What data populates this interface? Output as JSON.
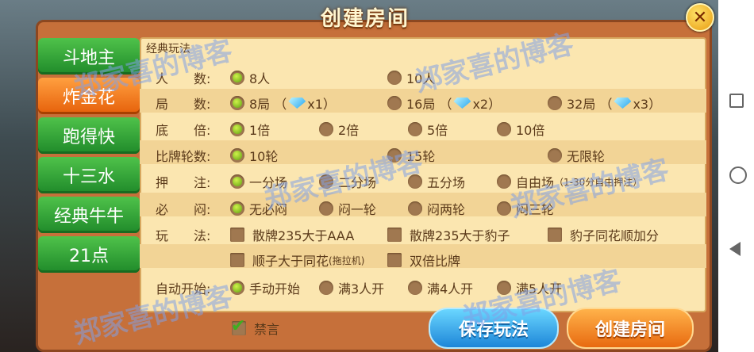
{
  "title": "创建房间",
  "close_icon_glyph": "✕",
  "tabs": [
    {
      "label": "斗地主",
      "active": false
    },
    {
      "label": "炸金花",
      "active": true
    },
    {
      "label": "跑得快",
      "active": false
    },
    {
      "label": "十三水",
      "active": false
    },
    {
      "label": "经典牛牛",
      "active": false
    },
    {
      "label": "21点",
      "active": false
    }
  ],
  "section_label": "经典玩法",
  "rows": {
    "players": {
      "label": "人　　数:",
      "options": [
        "8人",
        "10人"
      ],
      "selected": 0
    },
    "rounds": {
      "label": "局　　数:",
      "options": [
        {
          "pre": "8局 （",
          "post": "x1）"
        },
        {
          "pre": "16局 （",
          "post": "x2）"
        },
        {
          "pre": "32局 （",
          "post": "x3）"
        }
      ],
      "selected": 0
    },
    "base": {
      "label": "底　　倍:",
      "options": [
        "1倍",
        "2倍",
        "5倍",
        "10倍"
      ],
      "selected": 0
    },
    "compare": {
      "label": "比牌轮数:",
      "options": [
        "10轮",
        "15轮",
        "无限轮"
      ],
      "selected": 0
    },
    "bet": {
      "label": "押　　注:",
      "options": [
        "一分场",
        "二分场",
        "五分场"
      ],
      "free": {
        "main": "自由场",
        "sub": "（1-30分自由押注）"
      },
      "selected": 0
    },
    "blind": {
      "label": "必　　闷:",
      "options": [
        "无必闷",
        "闷一轮",
        "闷两轮",
        "闷三轮"
      ],
      "selected": 0
    },
    "play": {
      "label": "玩　　法:",
      "options": [
        "散牌235大于AAA",
        "散牌235大于豹子",
        "豹子同花顺加分",
        "双倍比牌"
      ],
      "straight": {
        "main": "顺子大于同花",
        "sub": "(拖拉机)"
      }
    },
    "autostart": {
      "label": "自动开始:",
      "options": [
        "手动开始",
        "满3人开",
        "满4人开",
        "满5人开"
      ],
      "selected": 0
    }
  },
  "mute_label": "禁言",
  "save_button": "保存玩法",
  "create_button": "创建房间",
  "watermark": "郑家喜的博客"
}
